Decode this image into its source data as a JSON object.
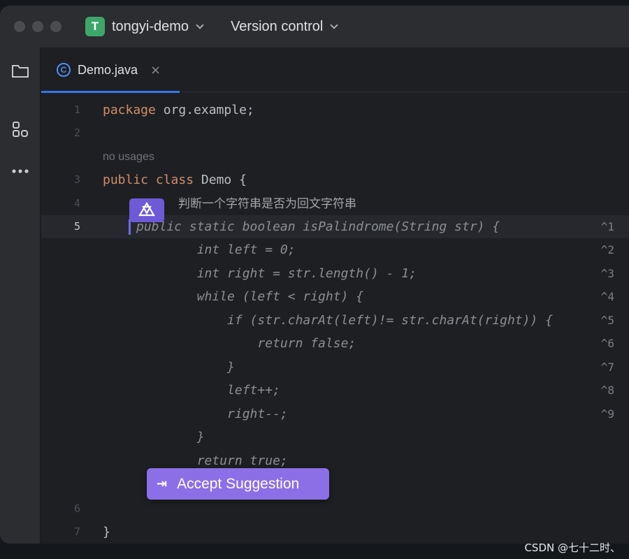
{
  "titlebar": {
    "project_initial": "T",
    "project_name": "tongyi-demo",
    "vcs_label": "Version control"
  },
  "tab": {
    "icon_letter": "C",
    "label": "Demo.java",
    "close": "×"
  },
  "code": {
    "line1": {
      "num": "1",
      "kw": "package",
      "rest": " org.example;"
    },
    "line2": {
      "num": "2"
    },
    "usages": "no usages",
    "line3": {
      "num": "3",
      "kw1": "public",
      "kw2": "class",
      "rest": " Demo {"
    },
    "line4": {
      "num": "4",
      "comment": "判断一个字符串是否为回文字符串"
    },
    "line5": {
      "num": "5",
      "ghost": "public static boolean isPalindrome(String str) {"
    },
    "ghost_lines": [
      "        int left = 0;",
      "        int right = str.length() - 1;",
      "        while (left < right) {",
      "            if (str.charAt(left)!= str.charAt(right)) {",
      "                return false;",
      "            }",
      "            left++;",
      "            right--;",
      "        }",
      "        return true;",
      "    }"
    ],
    "line6": {
      "num": "6"
    },
    "line7": {
      "num": "7",
      "rest": "}"
    },
    "shortcuts": [
      "^1",
      "^2",
      "^3",
      "^4",
      "^5",
      "^6",
      "^7",
      "^8",
      "^9"
    ]
  },
  "accept": {
    "icon": "⇥",
    "label": "Accept Suggestion"
  },
  "watermark": "CSDN @七十二时、",
  "colors": {
    "accent": "#3574f0",
    "ai_purple": "#8b6fe6",
    "keyword": "#cf8e6d"
  }
}
